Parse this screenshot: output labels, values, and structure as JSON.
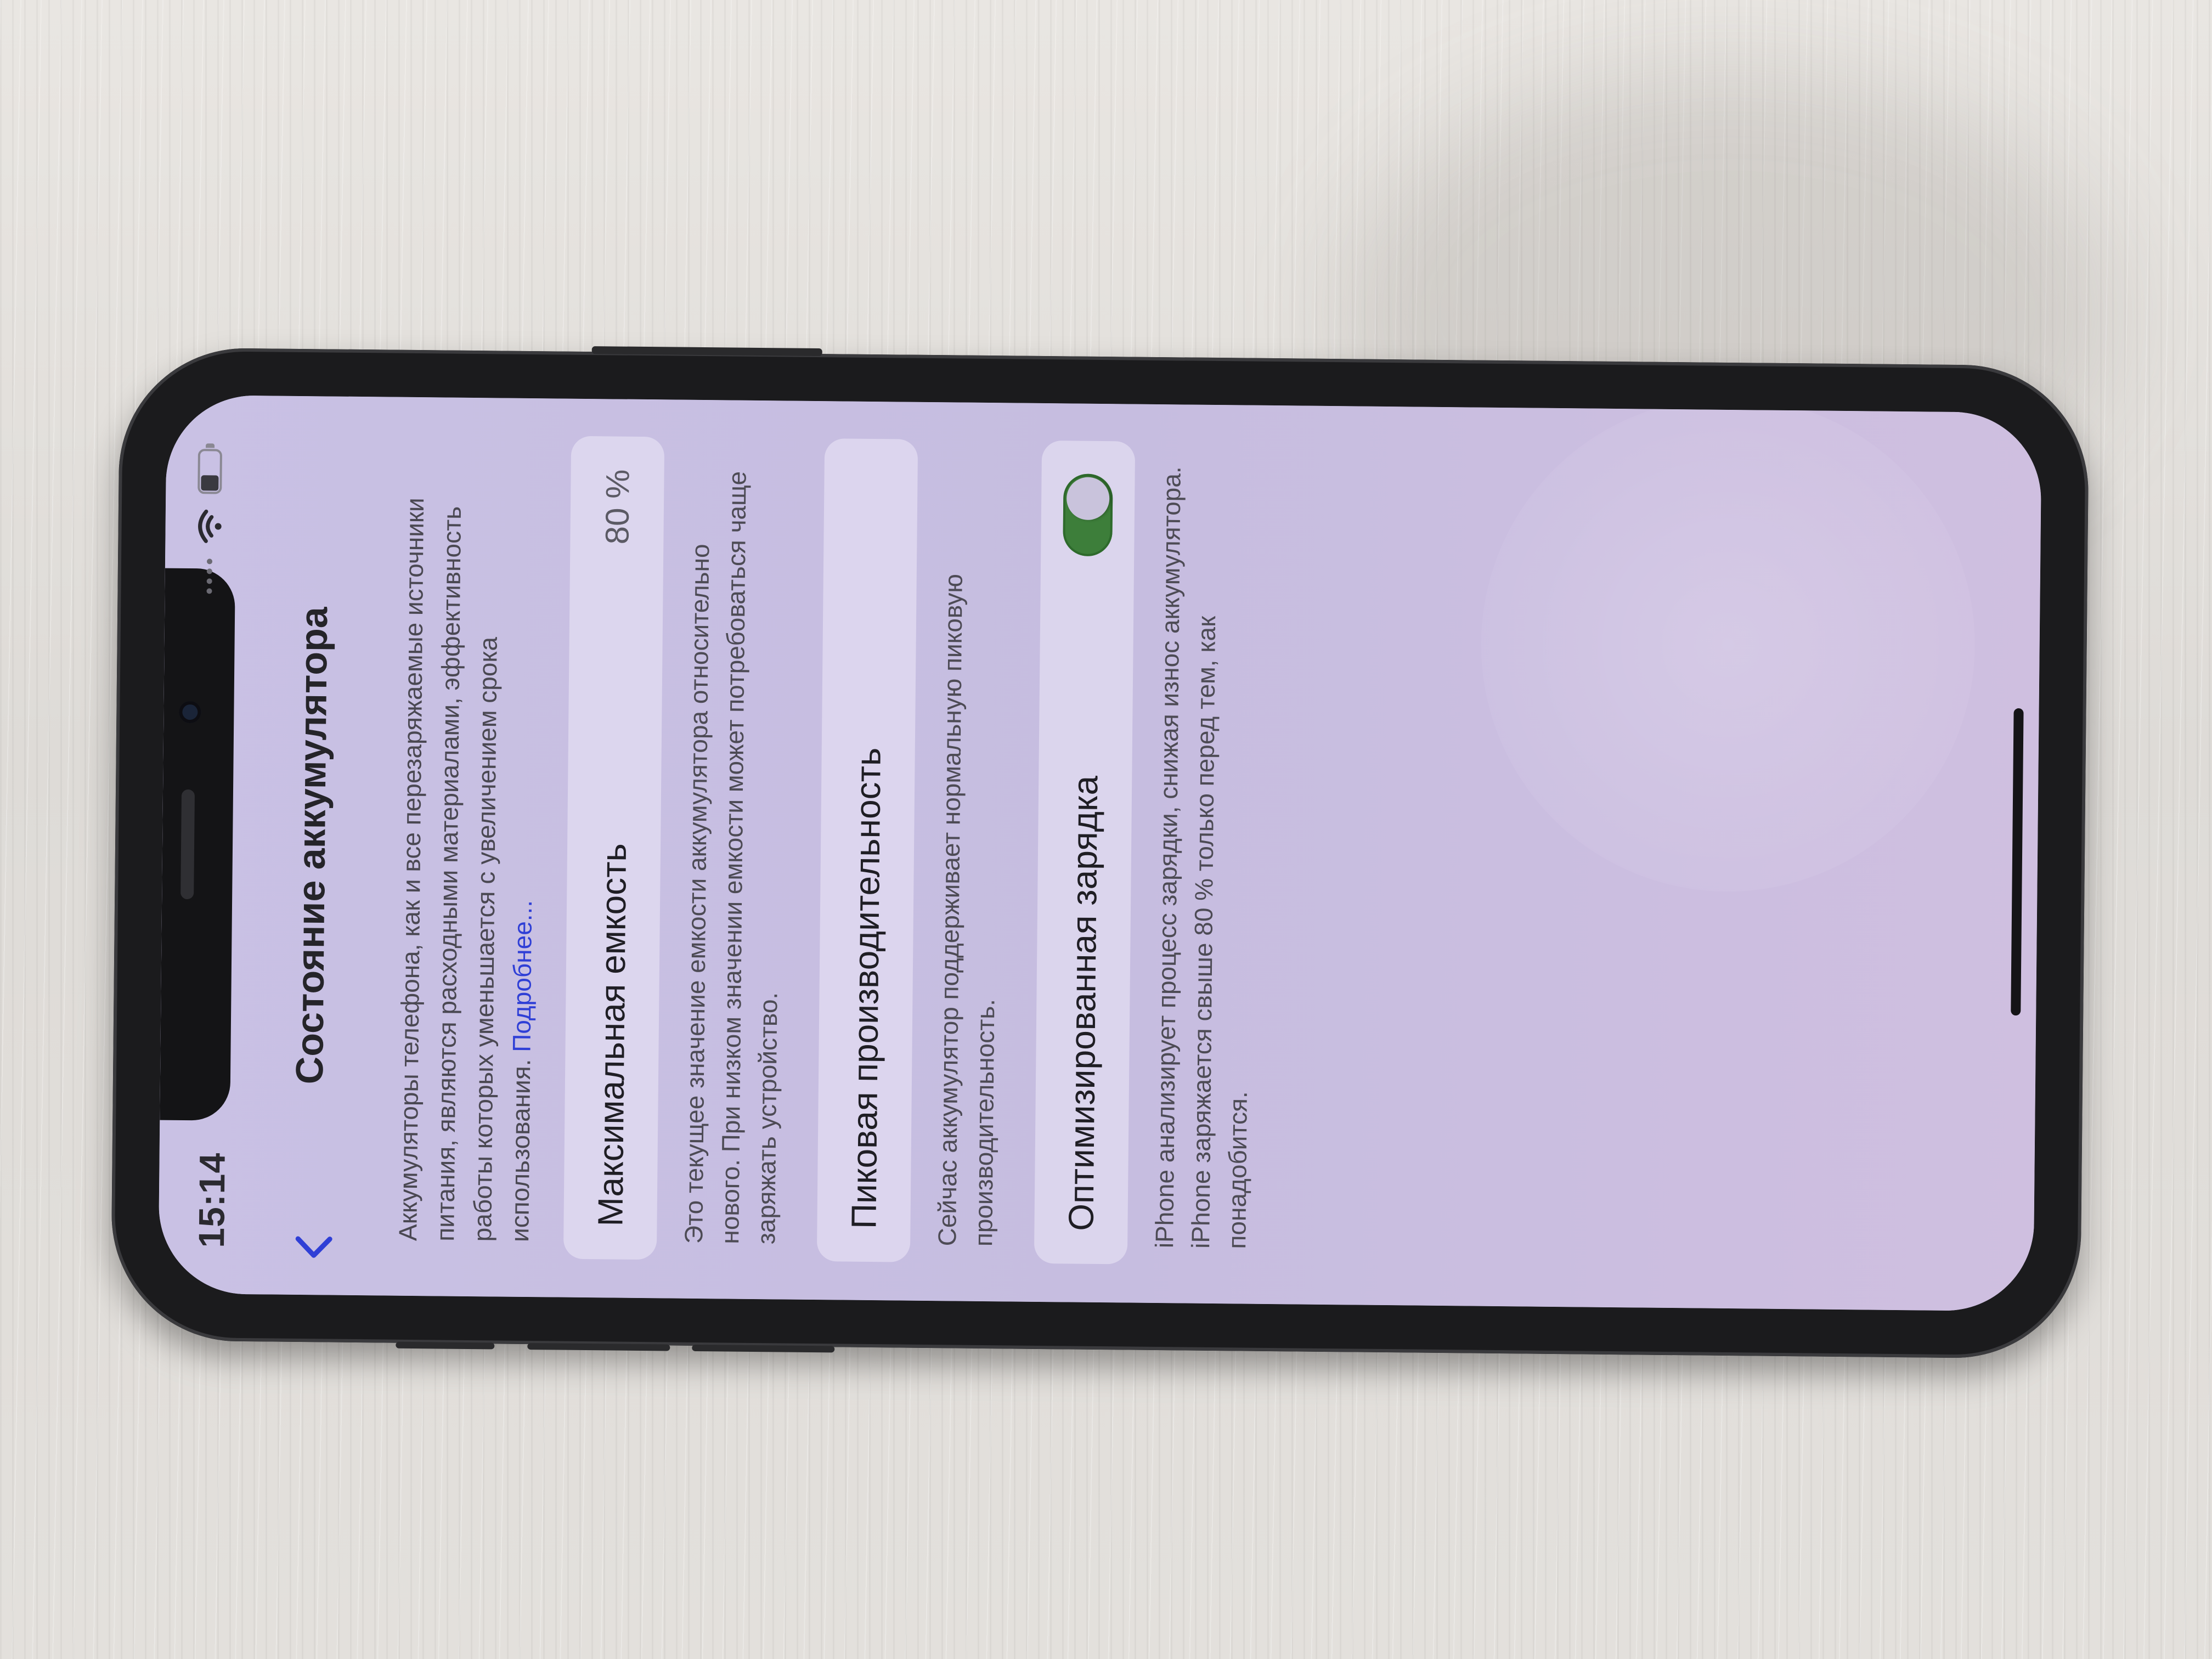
{
  "status_bar": {
    "time": "15:14",
    "icons": [
      "signal-dots-icon",
      "wifi-icon",
      "battery-icon"
    ]
  },
  "nav": {
    "back_icon": "chevron-left-icon",
    "title": "Состояние аккумулятора"
  },
  "intro": {
    "text": "Аккумуляторы телефона, как и все перезаряжаемые источники питания, являются расходными материалами, эффективность работы которых уменьшается с увеличением срока использования.",
    "link": "Подробнее..."
  },
  "max_capacity": {
    "label": "Максимальная емкость",
    "value": "80 %",
    "footnote": "Это текущее значение емкости аккумулятора относительно нового. При низком значении емкости может потребоваться чаще заряжать устройство."
  },
  "peak_performance": {
    "label": "Пиковая производительность",
    "footnote": "Сейчас аккумулятор поддерживает нормальную пиковую производительность."
  },
  "optimized_charging": {
    "label": "Оптимизированная зарядка",
    "enabled": true,
    "footnote": "iPhone анализирует процесс зарядки, снижая износ аккумулятора. iPhone заряжается свыше 80 % только перед тем, как понадобится."
  },
  "colors": {
    "accent": "#2f3fd6",
    "toggle_on": "#3d7e3a",
    "screen_bg": "#c9c1e4",
    "phone_frame": "#1b1b1d"
  }
}
